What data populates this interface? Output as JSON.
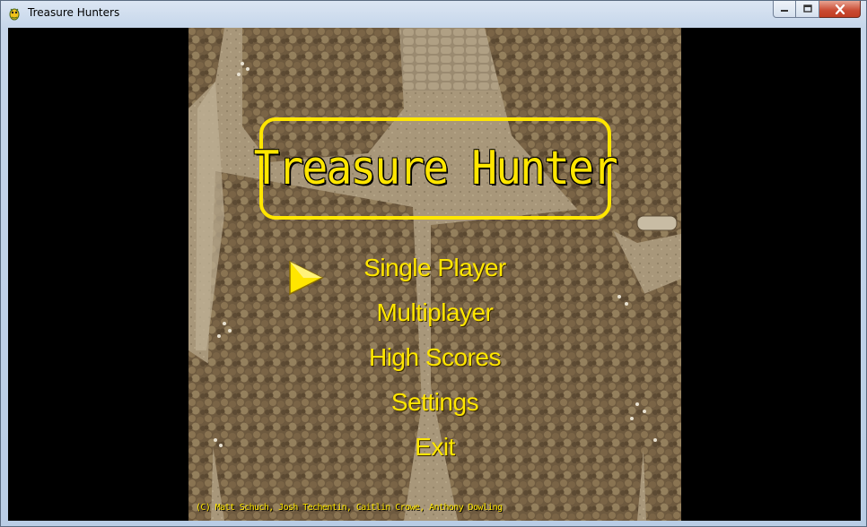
{
  "window": {
    "title": "Treasure Hunters",
    "icon": "pygame-snake-icon",
    "buttons": {
      "minimize": "minimize-icon",
      "maximize": "maximize-icon",
      "close": "close-icon"
    }
  },
  "game": {
    "title": "Treasure Hunter",
    "menu": [
      "Single Player",
      "Multiplayer",
      "High Scores",
      "Settings",
      "Exit"
    ],
    "selected_index": 0,
    "selector_icon": "triangle-arrow-icon",
    "credits": "(C) Matt Schuch, Josh Techentin, Caitlin Crowe, Anthony Dowling",
    "colors": {
      "text": "#ffe600",
      "background_tint": "#7d6a4d"
    }
  }
}
